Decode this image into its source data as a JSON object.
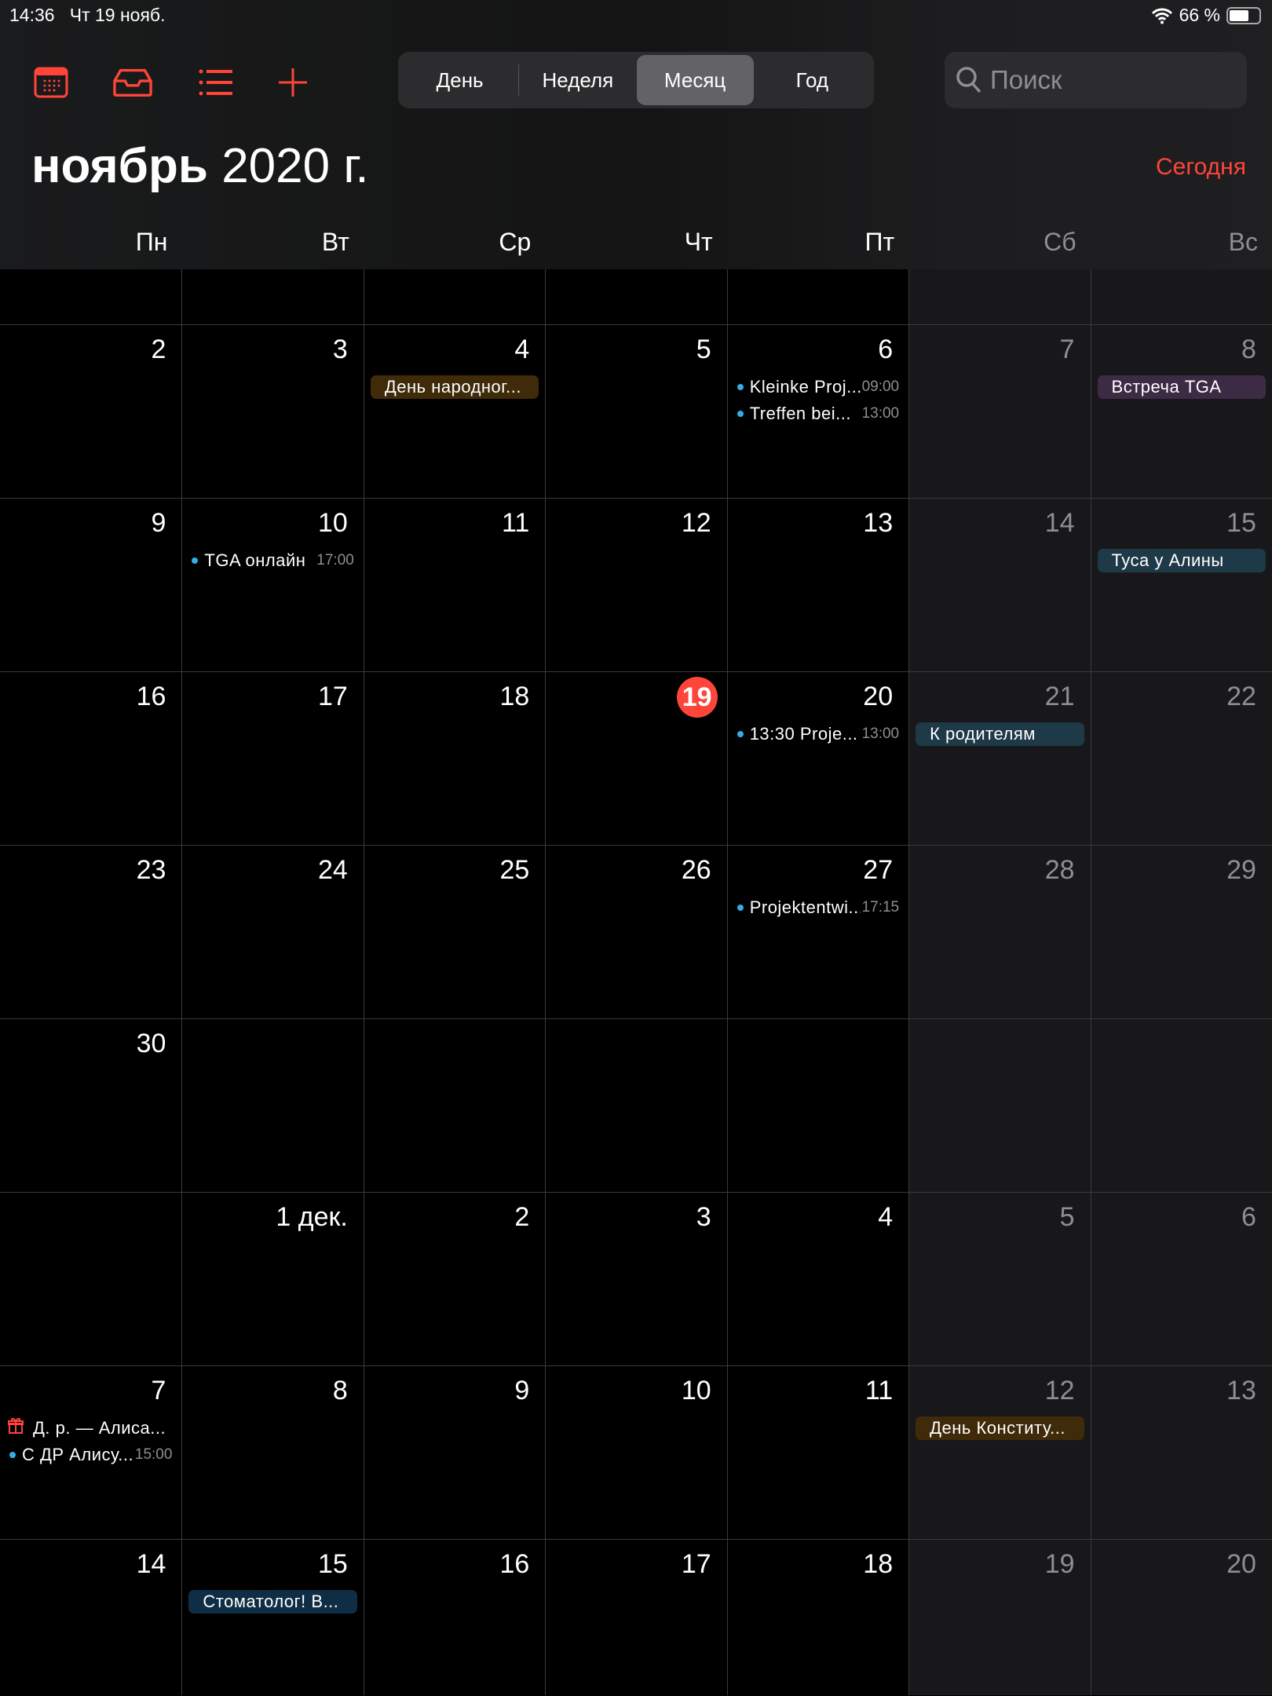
{
  "status": {
    "time": "14:36",
    "date": "Чт 19 нояб.",
    "battery": "66 %",
    "battery_level": 0.66
  },
  "toolbar": {
    "icons": [
      "calendar-icon",
      "inbox-icon",
      "list-icon",
      "plus-icon"
    ],
    "accent": "#ff453a"
  },
  "views": [
    {
      "label": "День",
      "active": false
    },
    {
      "label": "Неделя",
      "active": false
    },
    {
      "label": "Месяц",
      "active": true
    },
    {
      "label": "Год",
      "active": false
    }
  ],
  "search": {
    "placeholder": "Поиск",
    "value": ""
  },
  "header": {
    "month": "ноябрь",
    "year": "2020 г.",
    "today_label": "Сегодня"
  },
  "weekdays": [
    "Пн",
    "Вт",
    "Ср",
    "Чт",
    "Пт",
    "Сб",
    "Вс"
  ],
  "colors": {
    "dot": "#32ade6",
    "orange": "#3f2a09",
    "purple": "#3d2b45",
    "teal": "#1e3947",
    "navy": "#0f2e45",
    "gift": "#ff453a"
  },
  "weeks": [
    {
      "partial": true,
      "days": [
        {},
        {},
        {},
        {},
        {},
        {},
        {}
      ]
    },
    {
      "days": [
        {
          "n": "2"
        },
        {
          "n": "3"
        },
        {
          "n": "4",
          "events": [
            {
              "type": "pill",
              "title": "День народног...",
              "color": "orange"
            }
          ]
        },
        {
          "n": "5"
        },
        {
          "n": "6",
          "events": [
            {
              "type": "dot",
              "title": "Kleinke Proj...",
              "time": "09:00"
            },
            {
              "type": "dot",
              "title": "Treffen bei...",
              "time": "13:00"
            }
          ]
        },
        {
          "n": "7"
        },
        {
          "n": "8",
          "events": [
            {
              "type": "pill",
              "title": "Встреча TGA",
              "color": "purple"
            }
          ]
        }
      ]
    },
    {
      "days": [
        {
          "n": "9"
        },
        {
          "n": "10",
          "events": [
            {
              "type": "dot",
              "title": "TGA онлайн",
              "time": "17:00"
            }
          ]
        },
        {
          "n": "11"
        },
        {
          "n": "12"
        },
        {
          "n": "13"
        },
        {
          "n": "14"
        },
        {
          "n": "15",
          "events": [
            {
              "type": "pill",
              "title": "Туса у Алины",
              "color": "teal"
            }
          ]
        }
      ]
    },
    {
      "days": [
        {
          "n": "16"
        },
        {
          "n": "17"
        },
        {
          "n": "18"
        },
        {
          "n": "19",
          "today": true
        },
        {
          "n": "20",
          "events": [
            {
              "type": "dot",
              "title": "13:30 Proje...",
              "time": "13:00"
            }
          ]
        },
        {
          "n": "21",
          "events": [
            {
              "type": "pill",
              "title": "К родителям",
              "color": "teal"
            }
          ]
        },
        {
          "n": "22"
        }
      ]
    },
    {
      "days": [
        {
          "n": "23"
        },
        {
          "n": "24"
        },
        {
          "n": "25"
        },
        {
          "n": "26"
        },
        {
          "n": "27",
          "events": [
            {
              "type": "dot",
              "title": "Projektentwi...",
              "time": "17:15"
            }
          ]
        },
        {
          "n": "28"
        },
        {
          "n": "29"
        }
      ]
    },
    {
      "days": [
        {
          "n": "30"
        },
        {},
        {},
        {},
        {},
        {},
        {}
      ]
    },
    {
      "days": [
        {},
        {
          "n": "1 дек."
        },
        {
          "n": "2"
        },
        {
          "n": "3"
        },
        {
          "n": "4"
        },
        {
          "n": "5"
        },
        {
          "n": "6"
        }
      ]
    },
    {
      "days": [
        {
          "n": "7",
          "events": [
            {
              "type": "birthday",
              "title": "Д. р. — Алиса..."
            },
            {
              "type": "dot",
              "title": "С ДР Алису...",
              "time": "15:00"
            }
          ]
        },
        {
          "n": "8"
        },
        {
          "n": "9"
        },
        {
          "n": "10"
        },
        {
          "n": "11"
        },
        {
          "n": "12",
          "events": [
            {
              "type": "pill",
              "title": "День Конститу...",
              "color": "orange"
            }
          ]
        },
        {
          "n": "13"
        }
      ]
    },
    {
      "last": true,
      "days": [
        {
          "n": "14"
        },
        {
          "n": "15",
          "events": [
            {
              "type": "pill",
              "title": "Стоматолог! В...",
              "color": "navy"
            }
          ]
        },
        {
          "n": "16"
        },
        {
          "n": "17"
        },
        {
          "n": "18"
        },
        {
          "n": "19"
        },
        {
          "n": "20"
        }
      ]
    }
  ]
}
